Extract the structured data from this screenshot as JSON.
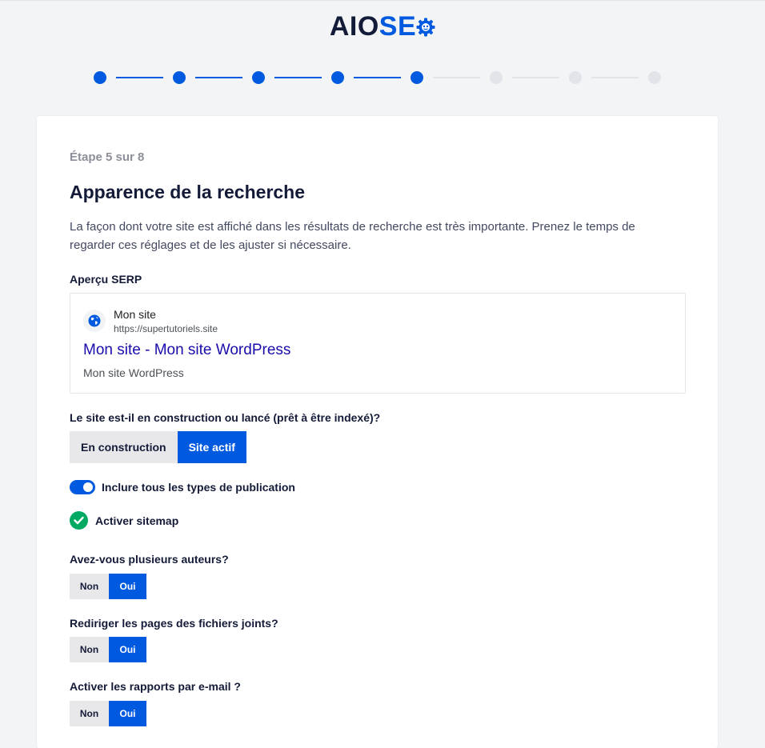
{
  "brand": {
    "part1": "AIO",
    "part2": "SE"
  },
  "progress": {
    "current_step": 5,
    "total_steps": 8
  },
  "step_label": "Étape 5 sur 8",
  "title": "Apparence de la recherche",
  "description": "La façon dont votre site est affiché dans les résultats de recherche est très importante. Prenez le temps de regarder ces réglages et de les ajuster si nécessaire.",
  "serp": {
    "label": "Aperçu SERP",
    "site_name": "Mon site",
    "url": "https://supertutoriels.site",
    "result_title": "Mon site - Mon site WordPress",
    "result_description": "Mon site WordPress"
  },
  "site_status": {
    "question": "Le site est-il en construction ou lancé (prêt à être indexé)?",
    "options": [
      "En construction",
      "Site actif"
    ],
    "selected": "Site actif"
  },
  "include_post_types": {
    "label": "Inclure tous les types de publication",
    "enabled": true
  },
  "sitemap": {
    "label": "Activer sitemap",
    "enabled": true
  },
  "multiple_authors": {
    "question": "Avez-vous plusieurs auteurs?",
    "options": [
      "Non",
      "Oui"
    ],
    "selected": "Oui"
  },
  "redirect_attachments": {
    "question": "Rediriger les pages des fichiers joints?",
    "options": [
      "Non",
      "Oui"
    ],
    "selected": "Oui"
  },
  "email_reports": {
    "question": "Activer les rapports par e-mail ?",
    "options": [
      "Non",
      "Oui"
    ],
    "selected": "Oui"
  },
  "colors": {
    "accent": "#005ae0",
    "success": "#00aa63",
    "inactive": "#e2e4e9",
    "serp_link": "#1a0dab"
  },
  "icons": {
    "brand_gear": "gear-icon",
    "favicon": "globe-icon",
    "check": "check-icon"
  }
}
